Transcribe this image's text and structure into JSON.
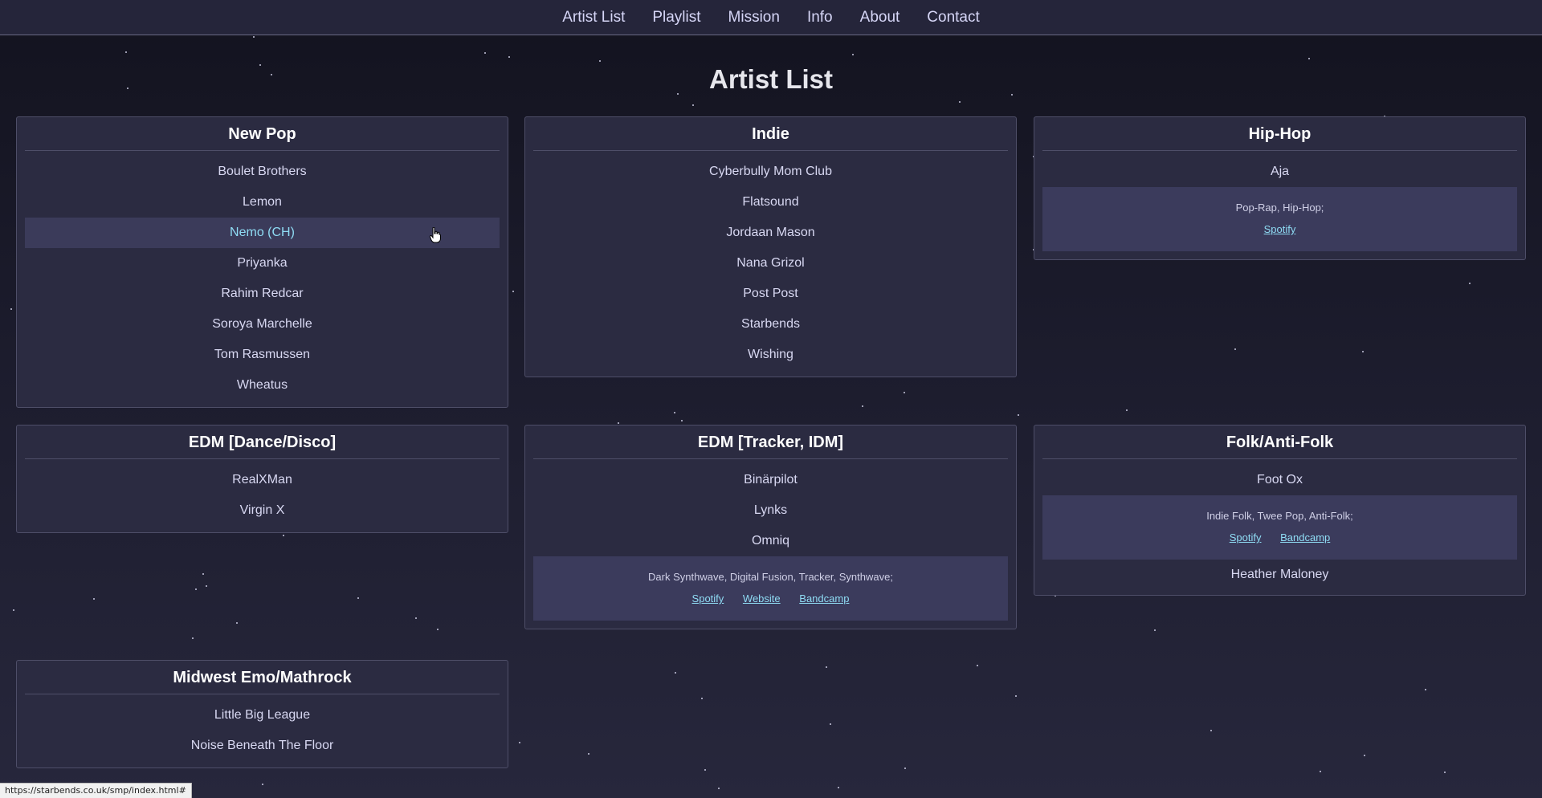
{
  "nav": {
    "items": [
      "Artist List",
      "Playlist",
      "Mission",
      "Info",
      "About",
      "Contact"
    ]
  },
  "page": {
    "title": "Artist List"
  },
  "cards": {
    "new_pop": {
      "title": "New Pop",
      "artists": [
        "Boulet Brothers",
        "Lemon",
        "Nemo (CH)",
        "Priyanka",
        "Rahim Redcar",
        "Soroya Marchelle",
        "Tom Rasmussen",
        "Wheatus"
      ]
    },
    "indie": {
      "title": "Indie",
      "artists": [
        "Cyberbully Mom Club",
        "Flatsound",
        "Jordaan Mason",
        "Nana Grizol",
        "Post Post",
        "Starbends",
        "Wishing"
      ]
    },
    "hiphop": {
      "title": "Hip-Hop",
      "artists": [
        "Aja"
      ],
      "details": {
        "genres": "Pop-Rap, Hip-Hop;",
        "links": [
          "Spotify"
        ]
      }
    },
    "edm_dance": {
      "title": "EDM [Dance/Disco]",
      "artists": [
        "RealXMan",
        "Virgin X"
      ]
    },
    "edm_tracker": {
      "title": "EDM [Tracker, IDM]",
      "artists": [
        "Binärpilot",
        "Lynks",
        "Omniq"
      ],
      "details": {
        "genres": "Dark Synthwave, Digital Fusion, Tracker, Synthwave;",
        "links": [
          "Spotify",
          "Website",
          "Bandcamp"
        ]
      }
    },
    "folk": {
      "title": "Folk/Anti-Folk",
      "artists": [
        "Foot Ox",
        "Heather Maloney"
      ],
      "details": {
        "genres": "Indie Folk, Twee Pop, Anti-Folk;",
        "links": [
          "Spotify",
          "Bandcamp"
        ]
      }
    },
    "midwest": {
      "title": "Midwest Emo/Mathrock",
      "artists": [
        "Little Big League",
        "Noise Beneath The Floor"
      ]
    }
  },
  "status_bar": {
    "url": "https://starbends.co.uk/smp/index.html#"
  },
  "colors": {
    "accent_link": "#8fdcf4",
    "card_bg": "#2b2b41",
    "details_bg": "#3b3b5c"
  }
}
